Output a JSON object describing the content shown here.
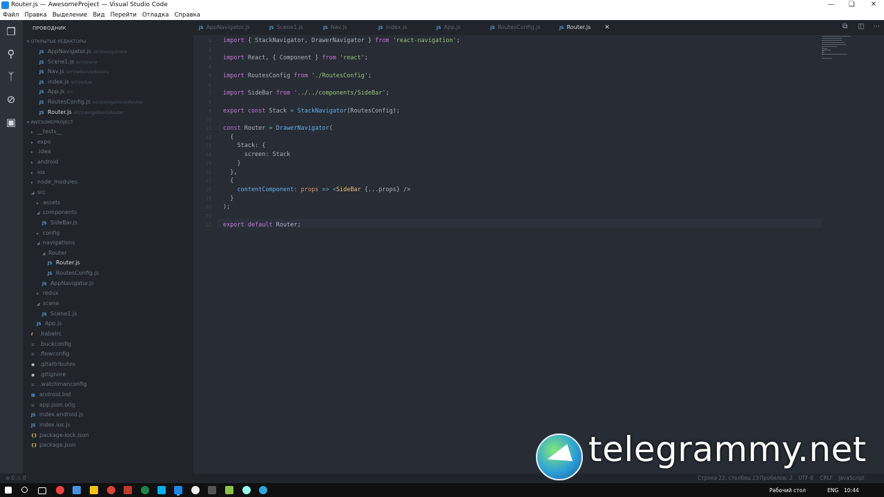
{
  "window": {
    "title": "Router.js — AwesomeProject — Visual Studio Code"
  },
  "menu": [
    "Файл",
    "Правка",
    "Выделение",
    "Вид",
    "Перейти",
    "Отладка",
    "Справка"
  ],
  "sidebar": {
    "title": "ПРОВОДНИК",
    "open_editors_label": "ОТКРЫТЫЕ РЕДАКТОРЫ",
    "open_editors": [
      {
        "name": "AppNavigator.js",
        "hint": "src\\navigations"
      },
      {
        "name": "Scene1.js",
        "hint": "src\\scene"
      },
      {
        "name": "Nav.js",
        "hint": "src\\redux\\reducers"
      },
      {
        "name": "index.js",
        "hint": "src\\redux"
      },
      {
        "name": "App.js",
        "hint": "src"
      },
      {
        "name": "RoutesConfig.js",
        "hint": "src\\navigations\\Router"
      },
      {
        "name": "Router.js",
        "hint": "src\\navigations\\Router"
      }
    ],
    "project_label": "AWESOMEPROJECT",
    "tree": [
      {
        "label": "__tests__",
        "type": "folder-closed"
      },
      {
        "label": "expo",
        "type": "folder-closed"
      },
      {
        "label": ".idea",
        "type": "folder-closed"
      },
      {
        "label": "android",
        "type": "folder-closed"
      },
      {
        "label": "ios",
        "type": "folder-closed"
      },
      {
        "label": "node_modules",
        "type": "folder-closed"
      },
      {
        "label": "src",
        "type": "folder-open"
      },
      {
        "label": "assets",
        "type": "folder-closed"
      },
      {
        "label": "components",
        "type": "folder-open"
      },
      {
        "label": "SideBar.js",
        "type": "js"
      },
      {
        "label": "config",
        "type": "folder-closed"
      },
      {
        "label": "navigations",
        "type": "folder-open"
      },
      {
        "label": "Router",
        "type": "folder-open"
      },
      {
        "label": "Router.js",
        "type": "js"
      },
      {
        "label": "RoutesConfig.js",
        "type": "js"
      },
      {
        "label": "AppNavigator.js",
        "type": "js"
      },
      {
        "label": "redux",
        "type": "folder-closed"
      },
      {
        "label": "scene",
        "type": "folder-open"
      },
      {
        "label": "Scene1.js",
        "type": "js"
      },
      {
        "label": "App.js",
        "type": "js"
      },
      {
        "label": ".babelrc",
        "type": "config"
      },
      {
        "label": ".buckconfig",
        "type": "file"
      },
      {
        "label": ".flowconfig",
        "type": "file"
      },
      {
        "label": ".gitattributes",
        "type": "git"
      },
      {
        "label": ".gitignore",
        "type": "git"
      },
      {
        "label": ".watchmanconfig",
        "type": "file"
      },
      {
        "label": "android.bat",
        "type": "win"
      },
      {
        "label": "app.json.orig",
        "type": "file"
      },
      {
        "label": "index.android.js",
        "type": "js"
      },
      {
        "label": "index.ios.js",
        "type": "js"
      },
      {
        "label": "package-lock.json",
        "type": "json"
      },
      {
        "label": "package.json",
        "type": "json"
      }
    ]
  },
  "tabs": [
    "AppNavigator.js",
    "Scene1.js",
    "Nav.js",
    "index.js",
    "App.js",
    "RoutesConfig.js",
    "Router.js"
  ],
  "code_lines": [
    "import { StackNavigator, DrawerNavigator } from 'react-navigation';",
    "",
    "import React, { Component } from 'react';",
    "",
    "import RoutesConfig from './RoutesConfig';",
    "",
    "import SideBar from '../../components/SideBar';",
    "",
    "export const Stack = StackNavigator(RoutesConfig);",
    "",
    "const Router = DrawerNavigator(",
    "  {",
    "    Stack: {",
    "      screen: Stack",
    "    }",
    "  },",
    "  {",
    "    contentComponent: props => <SideBar {...props} />",
    "  }",
    ");",
    "",
    "export default Router;"
  ],
  "status": {
    "problems": "⊗ 0 ⚠ 0",
    "position": "Строка 22, столбец 23",
    "spaces": "Пробелов: 2",
    "encoding": "UTF-8",
    "eol": "CRLF",
    "language": "JavaScript"
  },
  "taskbar": {
    "desktop": "Рабочий стол",
    "lang": "ENG",
    "time": "10:44"
  },
  "watermark": "telegrammy.net",
  "colors": {
    "editor_bg": "#282c34",
    "sidebar_bg": "#21252b",
    "keyword": "#c678dd",
    "string": "#98c379",
    "function": "#61afef"
  }
}
